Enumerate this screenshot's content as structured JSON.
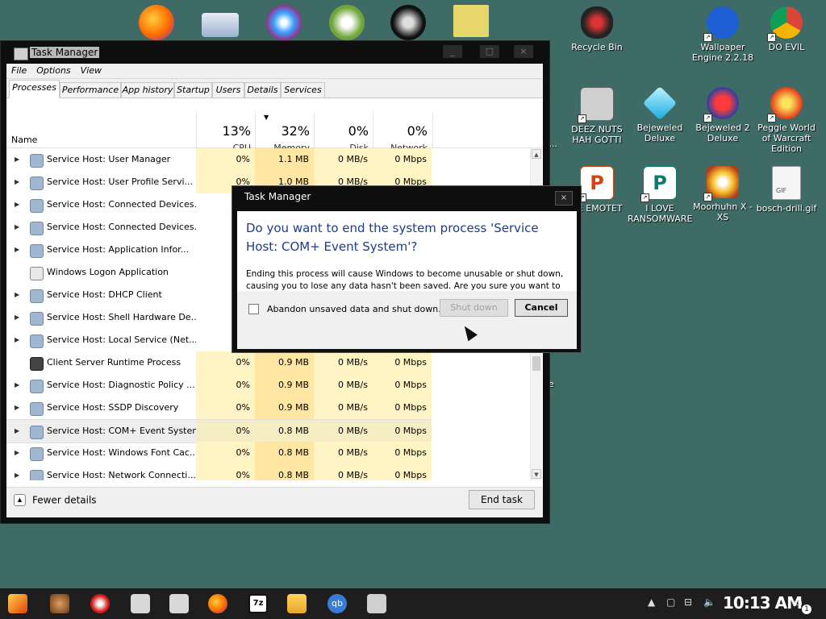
{
  "desktop_icons": [
    {
      "label": "Recycle Bin",
      "icon": "recycle-bin-icon"
    },
    {
      "label": "Wallpaper Engine 2.2.18",
      "icon": "wallpaper-engine-icon"
    },
    {
      "label": "DO EVIL",
      "icon": "chrome-icon"
    },
    {
      "label": "DEEZ NUTS HAH GOTTI",
      "icon": "shortcut-stack-icon"
    },
    {
      "label": "Bejeweled Deluxe",
      "icon": "gem-icon"
    },
    {
      "label": "Bejeweled 2 Deluxe",
      "icon": "gem-2-icon"
    },
    {
      "label": "Peggle World of Warcraft Edition",
      "icon": "peggle-icon"
    },
    {
      "label": "VE EMOTET",
      "icon": "powerpoint-icon"
    },
    {
      "label": "I LOVE RANSOMWARE",
      "icon": "publisher-icon"
    },
    {
      "label": "Moorhuhn X - XS",
      "icon": "moorhuhn-icon"
    },
    {
      "label": "bosch-drill.gif",
      "icon": "gif-file-icon"
    },
    {
      "label": "G...",
      "icon": "partial-icon"
    },
    {
      "label": "e",
      "icon": "partial-icon"
    }
  ],
  "task_manager": {
    "title": "Task Manager",
    "menu": [
      "File",
      "Options",
      "View"
    ],
    "tabs": [
      "Processes",
      "Performance",
      "App history",
      "Startup",
      "Users",
      "Details",
      "Services"
    ],
    "columns": {
      "name": "Name",
      "cpu": {
        "pct": "13%",
        "label": "CPU"
      },
      "memory": {
        "pct": "32%",
        "label": "Memory"
      },
      "disk": {
        "pct": "0%",
        "label": "Disk"
      },
      "network": {
        "pct": "0%",
        "label": "Network"
      }
    },
    "rows": [
      {
        "name": "Service Host: User Manager",
        "cpu": "0%",
        "mem": "1.1 MB",
        "disk": "0 MB/s",
        "net": "0 Mbps"
      },
      {
        "name": "Service Host: User Profile Servi...",
        "cpu": "0%",
        "mem": "1.0 MB",
        "disk": "0 MB/s",
        "net": "0 Mbps"
      },
      {
        "name": "Service Host: Connected Devices...",
        "cpu": "",
        "mem": "",
        "disk": "",
        "net": ""
      },
      {
        "name": "Service Host: Connected Devices...",
        "cpu": "",
        "mem": "",
        "disk": "",
        "net": ""
      },
      {
        "name": "Service Host: Application Infor...",
        "cpu": "",
        "mem": "",
        "disk": "",
        "net": ""
      },
      {
        "name": "Windows Logon Application",
        "cpu": "",
        "mem": "",
        "disk": "",
        "net": ""
      },
      {
        "name": "Service Host: DHCP Client",
        "cpu": "",
        "mem": "",
        "disk": "",
        "net": ""
      },
      {
        "name": "Service Host: Shell Hardware De...",
        "cpu": "",
        "mem": "",
        "disk": "",
        "net": ""
      },
      {
        "name": "Service Host: Local Service (Net...",
        "cpu": "",
        "mem": "",
        "disk": "",
        "net": ""
      },
      {
        "name": "Client Server Runtime Process",
        "cpu": "0%",
        "mem": "0.9 MB",
        "disk": "0 MB/s",
        "net": "0 Mbps"
      },
      {
        "name": "Service Host: Diagnostic Policy ...",
        "cpu": "0%",
        "mem": "0.9 MB",
        "disk": "0 MB/s",
        "net": "0 Mbps"
      },
      {
        "name": "Service Host: SSDP Discovery",
        "cpu": "0%",
        "mem": "0.9 MB",
        "disk": "0 MB/s",
        "net": "0 Mbps"
      },
      {
        "name": "Service Host: COM+ Event System",
        "cpu": "0%",
        "mem": "0.8 MB",
        "disk": "0 MB/s",
        "net": "0 Mbps"
      },
      {
        "name": "Service Host: Windows Font Cac...",
        "cpu": "0%",
        "mem": "0.8 MB",
        "disk": "0 MB/s",
        "net": "0 Mbps"
      },
      {
        "name": "Service Host: Network Connecti...",
        "cpu": "0%",
        "mem": "0.8 MB",
        "disk": "0 MB/s",
        "net": "0 Mbps"
      }
    ],
    "fewer_details": "Fewer details",
    "end_task": "End task"
  },
  "dialog": {
    "title": "Task Manager",
    "question": "Do you want to end the system process 'Service Host: COM+ Event System'?",
    "message": "Ending this process will cause Windows to become unusable or shut down, causing you to lose any data hasn't been saved. Are you sure you want to continue?",
    "checkbox_label": "Abandon unsaved data and shut down.",
    "shutdown_label": "Shut down",
    "cancel_label": "Cancel"
  },
  "taskbar": {
    "clock": "10:13 AM",
    "notification_count": "1"
  }
}
